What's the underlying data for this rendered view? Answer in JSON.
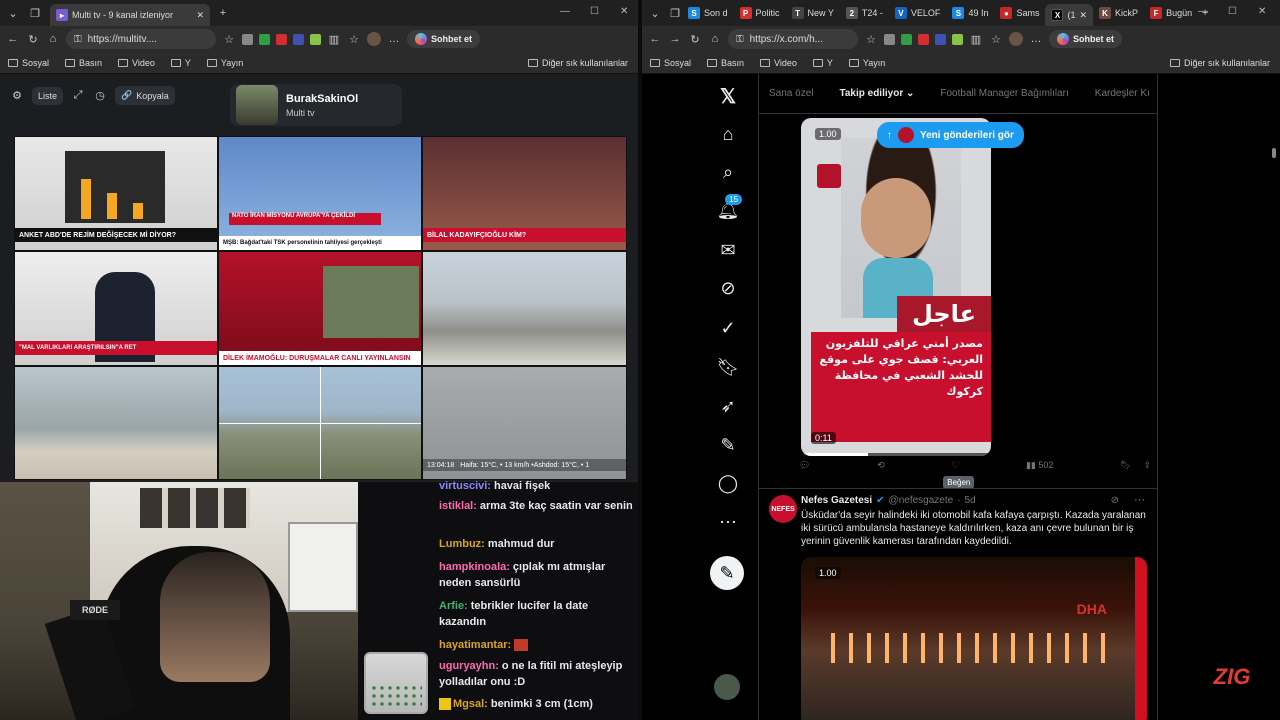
{
  "left_browser": {
    "tabs": [
      {
        "label": "Multi tv - 9 kanal izleniyor",
        "active": true
      }
    ],
    "url": "https://multitv....",
    "chat_button": "Sohbet et",
    "bookmarks": [
      "Sosyal",
      "Basın",
      "Video",
      "Y",
      "Yayın"
    ],
    "other_bookmarks": "Diğer sık kullanılanlar"
  },
  "multitv": {
    "toolbar": {
      "list": "Liste",
      "copy": "Kopyala"
    },
    "channel": {
      "name": "BurakSakinOl",
      "subtitle": "Multi tv"
    },
    "cells": [
      {
        "top_text": "ANKET ABD'DE REJİM DEĞİŞECEK Mİ DİYOR?",
        "ticker": "ANKET ABD'DE REJİM DEĞİŞECEK Mİ DİYOR?",
        "color": "#c8102e"
      },
      {
        "top_text": "NATO İRAN MİSYONU AVRUPA'YA ÇEKİLDİ",
        "ticker": "MŞB: Bağdat'taki TSK personelinin tahliyesi gerçekleşti",
        "color": "#c8102e"
      },
      {
        "top_text": "HABER TÜRK",
        "ticker": "BİLAL KADAYIFÇIOĞLU KİM?",
        "color": "#c8102e"
      },
      {
        "top_text": "halk tv",
        "ticker": "\"MAL VARLIKLARI ARAŞTIRILSIN\"A RET",
        "color": "#c8102e"
      },
      {
        "top_text": "sözcü",
        "ticker": "DİLEK İMAMOĞLU: DURUŞMALAR CANLI YAYINLANSIN",
        "color": "#c8102e"
      },
      {
        "top_text": "",
        "ticker": "",
        "color": ""
      },
      {
        "top_text": "",
        "ticker": "",
        "color": ""
      },
      {
        "top_text": "",
        "ticker": "",
        "color": ""
      },
      {
        "top_text": "13:04:18",
        "ticker": "Haifa: 15°C, • 13 km/h   •Ashdod: 15°C, • 1",
        "color": ""
      }
    ]
  },
  "chat": {
    "messages": [
      {
        "user": "virtuscivi:",
        "text": "havai fişek",
        "color": "#8a8aff"
      },
      {
        "user": "istiklal:",
        "text": "arma 3te kaç saatin var senin",
        "color": "#ff69b4"
      },
      {
        "user": "Lumbuz:",
        "text": "mahmud dur",
        "color": "#daa520"
      },
      {
        "user": "hampkinoala:",
        "text": "çıplak mı atmışlar neden sansürlü",
        "color": "#ff69b4"
      },
      {
        "user": "Arfie:",
        "text": "tebrikler lucifer la date kazandın",
        "color": "#3cb371"
      },
      {
        "user": "hayatimantar:",
        "text": "",
        "color": "#daa520"
      },
      {
        "user": "uguryayhn:",
        "text": "o ne la fitil mi ateşleyip yolladılar onu :D",
        "color": "#ff69b4"
      },
      {
        "user": "Mgsal:",
        "text": "benimki 3 cm (1cm)",
        "color": "#daa520"
      }
    ]
  },
  "right_browser": {
    "tabs": [
      "Son d",
      "Politic",
      "New Y",
      "T24 -",
      "VELOF",
      "49 In",
      "Sams",
      "(1",
      "KickP",
      "Bugün"
    ],
    "url": "https://x.com/h...",
    "chat_button": "Sohbet et",
    "bookmarks": [
      "Sosyal",
      "Basın",
      "Video",
      "Y",
      "Yayın"
    ],
    "other_bookmarks": "Diğer sık kullanılanlar"
  },
  "x": {
    "tabs": [
      "Sana özel",
      "Takip ediliyor",
      "Football Manager Bağımlıları",
      "Kardeşler Kı"
    ],
    "notif_badge": "15",
    "new_posts": "Yeni gönderileri gör",
    "video": {
      "speed": "1.00",
      "headline": "عاجل",
      "body": "مصدر أمني عراقي للتلفزيون العربي: قصف جوي على موقع للحشد الشعبي في محافظة كركوك",
      "time": "0:11",
      "progress": 0.35
    },
    "actions": {
      "views": "502",
      "like_tooltip": "Beğen"
    },
    "post2": {
      "name": "Nefes Gazetesi",
      "handle": "@nefesgazete",
      "time": "5d",
      "avatar": "NEFES",
      "text": "Üsküdar'da seyir halindeki iki otomobil kafa kafaya çarpıştı. Kazada yaralanan iki sürücü ambulansla hastaneye kaldırılırken, kaza anı çevre bulunan bir iş yerinin güvenlik kamerası tarafından kaydedildi.",
      "speed": "1.00",
      "watermark": "DHA"
    }
  },
  "overlay_logo": "ZIG"
}
